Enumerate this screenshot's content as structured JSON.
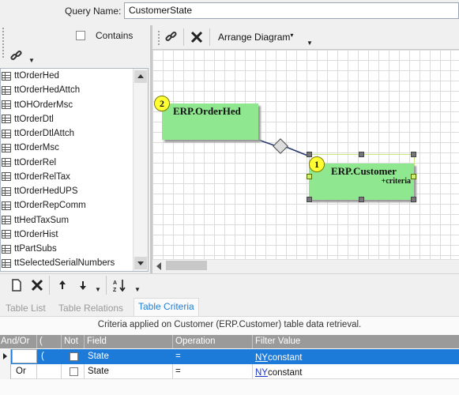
{
  "query": {
    "label": "Query Name:",
    "value": "CustomerState"
  },
  "left_panel": {
    "contains_label": "Contains",
    "contains_checked": false,
    "tables": [
      "ttOrderHed",
      "ttOrderHedAttch",
      "ttOHOrderMsc",
      "ttOrderDtl",
      "ttOrderDtlAttch",
      "ttOrderMsc",
      "ttOrderRel",
      "ttOrderRelTax",
      "ttOrderHedUPS",
      "ttOrderRepComm",
      "ttHedTaxSum",
      "ttOrderHist",
      "ttPartSubs",
      "ttSelectedSerialNumbers"
    ]
  },
  "diagram": {
    "arrange_label": "Arrange Diagram",
    "nodes": [
      {
        "badge": "2",
        "title": "ERP.OrderHed",
        "subtitle": ""
      },
      {
        "badge": "1",
        "title": "ERP.Customer",
        "subtitle": "+criteria"
      }
    ],
    "colors": {
      "node_fill": "#8fe88f",
      "badge_fill": "#ffff33",
      "selection": "#c7e880"
    }
  },
  "bottom_toolbar": {
    "icons": [
      "new-icon",
      "delete-icon",
      "move-up-icon",
      "move-down-icon",
      "sort-icon"
    ]
  },
  "tabs": [
    "Table List",
    "Table Relations",
    "Table Criteria"
  ],
  "active_tab": "Table Criteria",
  "criteria": {
    "caption": "Criteria applied on Customer (ERP.Customer)  table data retrieval.",
    "columns": [
      "And/Or",
      "(",
      "Not",
      "Field",
      "Operation",
      "Filter Value"
    ],
    "rows": [
      {
        "andor": "",
        "paren": "(",
        "not": false,
        "field": "State",
        "operation": "=",
        "filter_link": "NY",
        "filter_type": "constant"
      },
      {
        "andor": "Or",
        "paren": "",
        "not": false,
        "field": "State",
        "operation": "=",
        "filter_link": "NY",
        "filter_type": "constant"
      }
    ],
    "colors": {
      "header": "#9a9a9a",
      "selected_row": "#1c7ad9",
      "active_tab": "#1e7fd6"
    }
  }
}
